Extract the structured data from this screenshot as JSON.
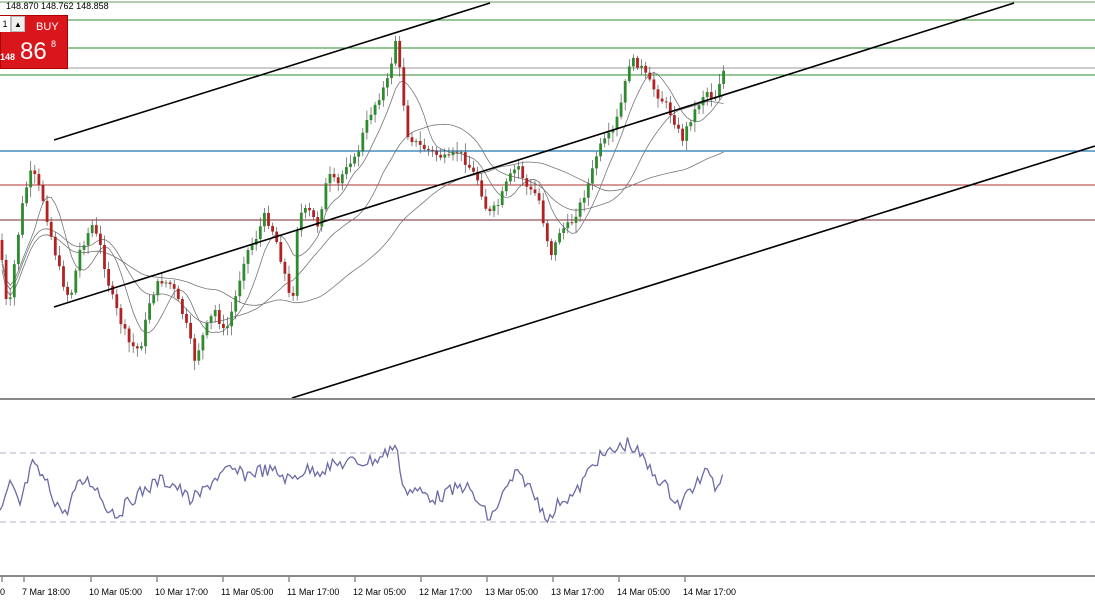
{
  "quote": {
    "ohlc_text": "148.870 148.762 148.858"
  },
  "one_click_panel": {
    "lot_value": "1",
    "stepper_glyph": "▲",
    "buy_label": "BUY",
    "price_prefix": "148",
    "price_big": "86",
    "price_sup": "8",
    "panel_color": "#d9161c"
  },
  "time_axis": {
    "labels": [
      "0",
      "7 Mar 18:00",
      "10 Mar 05:00",
      "10 Mar 17:00",
      "11 Mar 05:00",
      "11 Mar 17:00",
      "12 Mar 05:00",
      "12 Mar 17:00",
      "13 Mar 05:00",
      "13 Mar 17:00",
      "14 Mar 05:00",
      "14 Mar 17:00"
    ]
  },
  "chart_data": {
    "type": "candlestick",
    "panes": [
      "price",
      "oscillator"
    ],
    "horizontal_levels": [
      {
        "color": "#2e8b2e",
        "style": "solid"
      },
      {
        "color": "#2e8b2e",
        "style": "solid"
      },
      {
        "color": "#999999",
        "style": "solid"
      },
      {
        "color": "#2e8b2e",
        "style": "solid"
      },
      {
        "color": "#1f78b4",
        "style": "solid"
      },
      {
        "color": "#b03030",
        "style": "solid"
      },
      {
        "color": "#7a2a2a",
        "style": "solid"
      }
    ],
    "trend_lines_color": "#000000",
    "candle_up_color": "#2e8b2e",
    "candle_down_color": "#b22222",
    "moving_average_color": "#777777",
    "oscillator_color": "#6a6aa8",
    "oscillator_guide_color": "#9999bb"
  }
}
